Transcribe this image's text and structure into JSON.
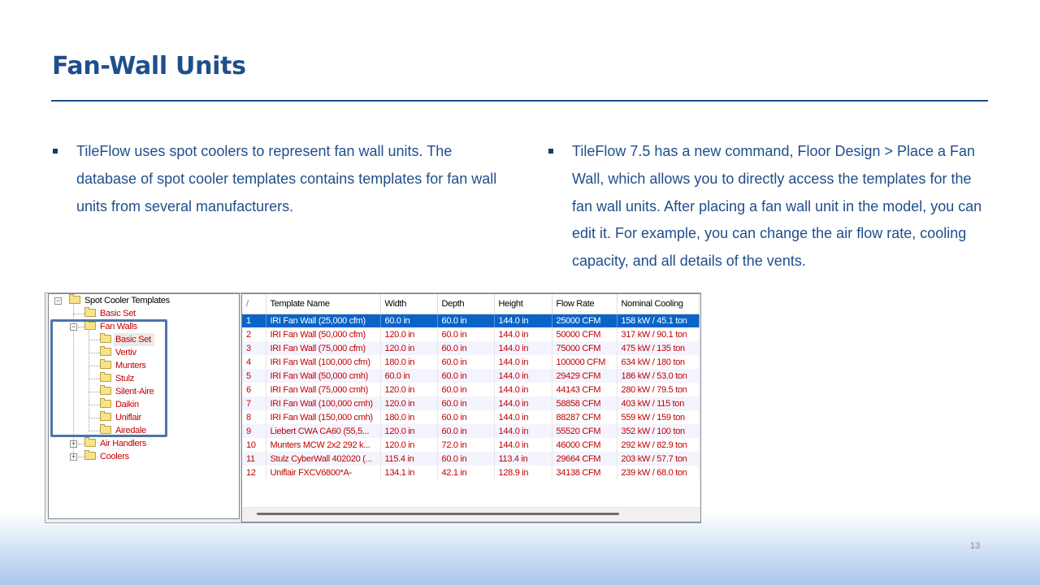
{
  "slide": {
    "title": "Fan-Wall Units",
    "left_bullet": "TileFlow uses spot coolers to represent fan wall units. The database of spot cooler templates contains templates for fan wall units from several manufacturers.",
    "right_bullet": "TileFlow 7.5 has a new command, Floor Design > Place a Fan Wall, which allows you to directly access the templates for the fan wall units. After placing a fan wall unit in the model, you can edit it. For example, you can change the air flow rate, cooling capacity, and all details of the vents.",
    "page_number": "13"
  },
  "tree": {
    "root": "Spot Cooler Templates",
    "basic_set": "Basic Set",
    "fan_walls": "Fan Walls",
    "fan_wall_children": [
      "Basic Set",
      "Vertiv",
      "Munters",
      "Stulz",
      "Silent-Aire",
      "Daikin",
      "Uniflair",
      "Airedale"
    ],
    "air_handlers": "Air Handlers",
    "coolers": "Coolers"
  },
  "grid": {
    "corner": "/",
    "columns": [
      "Template Name",
      "Width",
      "Depth",
      "Height",
      "Flow Rate",
      "Nominal Cooling"
    ],
    "selected_row": 0,
    "rows": [
      [
        "1",
        "IRI Fan Wall (25,000 cfm)",
        "60.0 in",
        "60.0 in",
        "144.0 in",
        "25000  CFM",
        "158 kW / 45.1 ton"
      ],
      [
        "2",
        "IRI Fan Wall (50,000 cfm)",
        "120.0 in",
        "60.0 in",
        "144.0 in",
        "50000  CFM",
        "317 kW / 90.1 ton"
      ],
      [
        "3",
        "IRI Fan Wall (75,000 cfm)",
        "120.0 in",
        "60.0 in",
        "144.0 in",
        "75000  CFM",
        "475 kW / 135 ton"
      ],
      [
        "4",
        "IRI Fan Wall (100,000 cfm)",
        "180.0 in",
        "60.0 in",
        "144.0 in",
        "100000  CFM",
        "634 kW / 180 ton"
      ],
      [
        "5",
        "IRI Fan Wall (50,000 cmh)",
        "60.0 in",
        "60.0 in",
        "144.0 in",
        "29429  CFM",
        "186 kW / 53.0 ton"
      ],
      [
        "6",
        "IRI Fan Wall (75,000 cmh)",
        "120.0 in",
        "60.0 in",
        "144.0 in",
        "44143  CFM",
        "280 kW / 79.5 ton"
      ],
      [
        "7",
        "IRI Fan Wall (100,000 cmh)",
        "120.0 in",
        "60.0 in",
        "144.0 in",
        "58858  CFM",
        "403 kW / 115 ton"
      ],
      [
        "8",
        "IRI Fan Wall (150,000 cmh)",
        "180.0 in",
        "60.0 in",
        "144.0 in",
        "88287  CFM",
        "559 kW / 159 ton"
      ],
      [
        "9",
        "Liebert CWA CA60 (55,5...",
        "120.0 in",
        "60.0 in",
        "144.0 in",
        "55520  CFM",
        "352 kW / 100 ton"
      ],
      [
        "10",
        "Munters MCW 2x2 292 k...",
        "120.0 in",
        "72.0 in",
        "144.0 in",
        "46000  CFM",
        "292 kW / 82.9 ton"
      ],
      [
        "11",
        "Stulz CyberWall 402020 (...",
        "115.4 in",
        "60.0 in",
        "113.4 in",
        "29664  CFM",
        "203 kW / 57.7 ton"
      ],
      [
        "12",
        "Uniflair FXCV6800*A-",
        "134.1 in",
        "42.1 in",
        "128.9 in",
        "34138  CFM",
        "239 kW / 68.0 ton"
      ]
    ]
  },
  "colors": {
    "title": "#1f4e8c",
    "row_text": "#c00000",
    "selection": "#0a64c8",
    "highlight_box": "#4d74a8"
  }
}
